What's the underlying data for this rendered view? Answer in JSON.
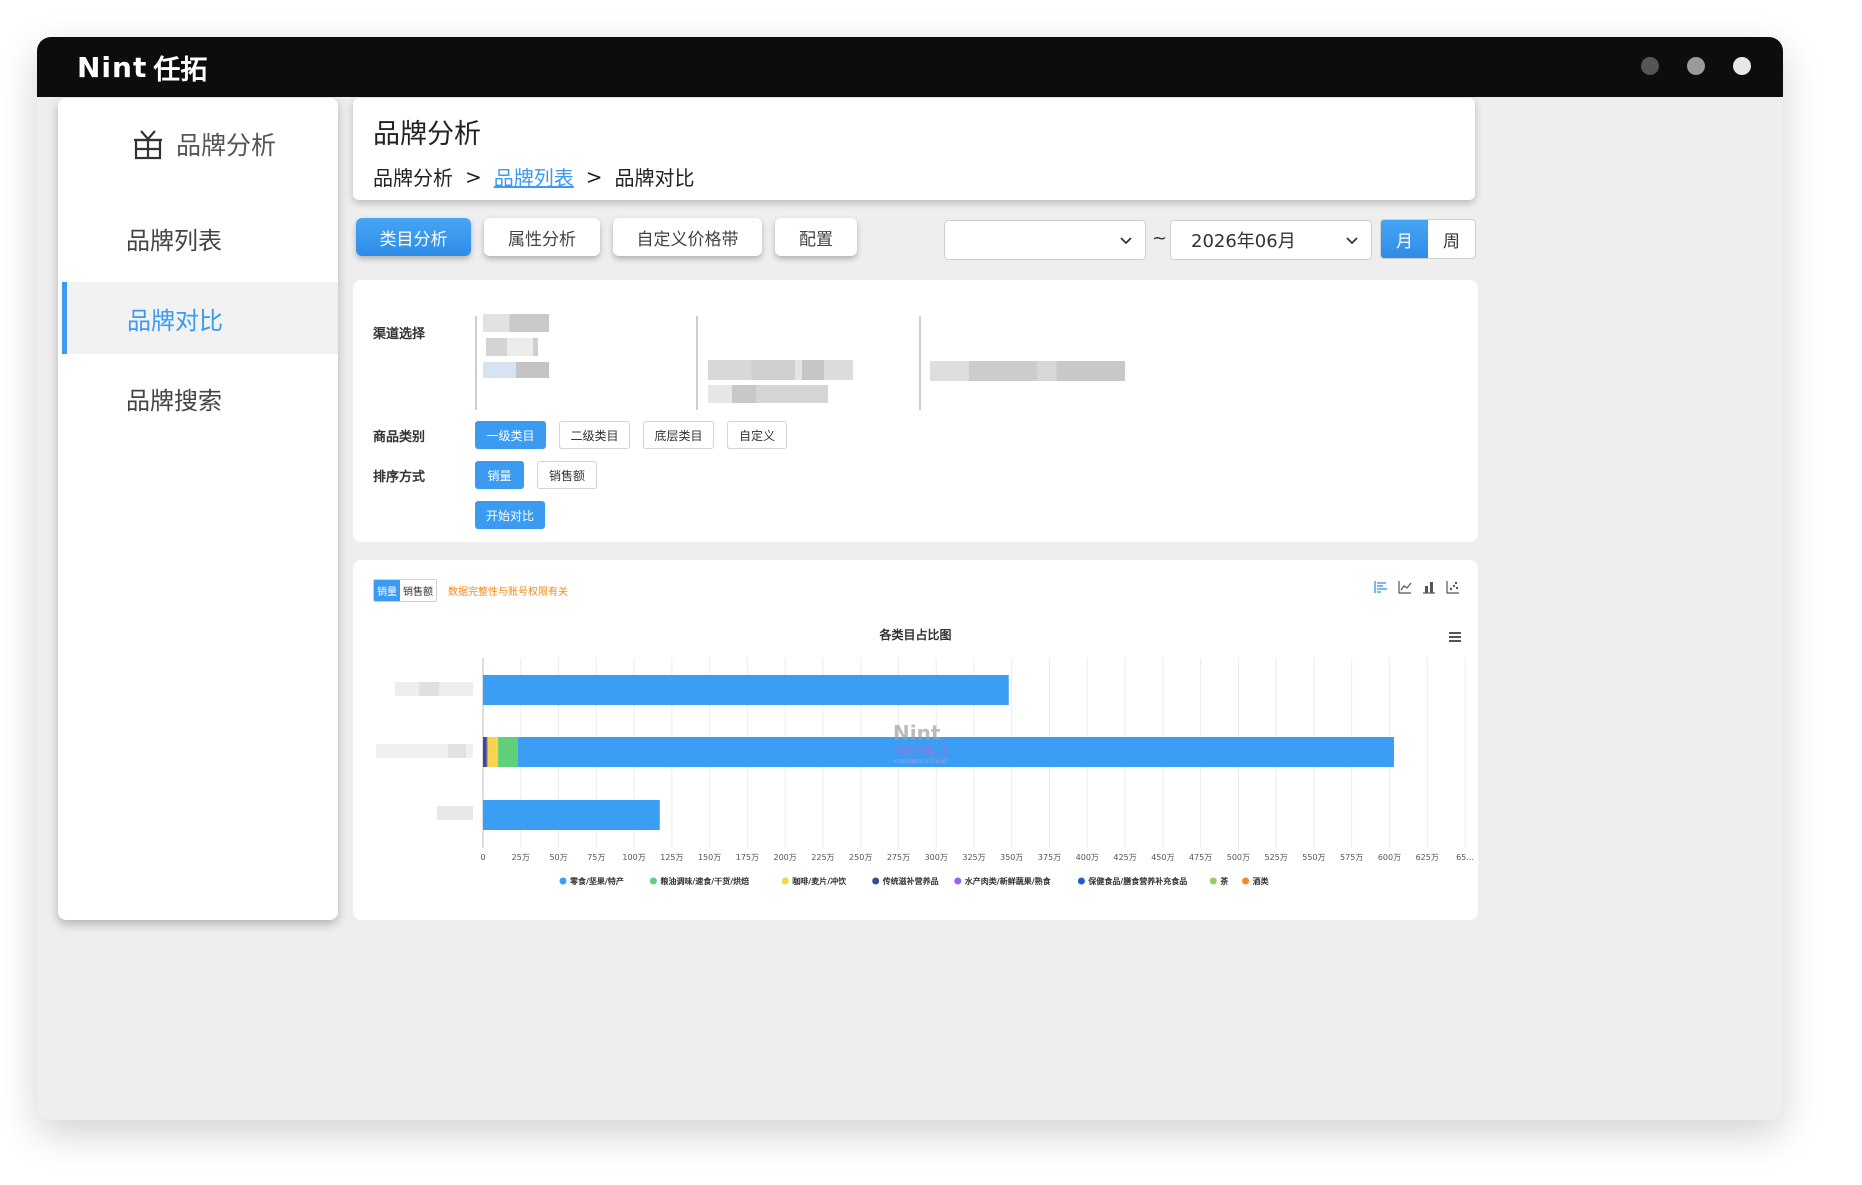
{
  "app": {
    "logo_latin": "Nint",
    "logo_cn": "任拓"
  },
  "window_dots": [
    "#555555",
    "#9a9a9a",
    "#e8e8e8"
  ],
  "sidebar": {
    "title": "品牌分析",
    "items": [
      {
        "label": "品牌列表",
        "active": false
      },
      {
        "label": "品牌对比",
        "active": true
      },
      {
        "label": "品牌搜索",
        "active": false
      }
    ]
  },
  "header": {
    "title": "品牌分析",
    "breadcrumb": [
      "品牌分析",
      "品牌列表",
      "品牌对比"
    ],
    "separator": ">"
  },
  "tabs": [
    {
      "label": "类目分析",
      "active": true
    },
    {
      "label": "属性分析",
      "active": false
    },
    {
      "label": "自定义价格带",
      "active": false
    },
    {
      "label": "配置",
      "active": false
    }
  ],
  "date_range": {
    "start": "",
    "separator": "~",
    "end": "2026年06月"
  },
  "period": {
    "month": "月",
    "week": "周",
    "selected": "月"
  },
  "filters": {
    "channel_label": "渠道选择",
    "category_label": "商品类别",
    "category_options": [
      "一级类目",
      "二级类目",
      "底层类目",
      "自定义"
    ],
    "sort_label": "排序方式",
    "sort_options": [
      "销量",
      "销售额"
    ],
    "start_button": "开始对比"
  },
  "chart_panel": {
    "toggle": [
      "销量",
      "销售额"
    ],
    "notice": "数据完整性与账号权限有关",
    "watermark": "Nint 任拓情报通 Intelligence Cloud"
  },
  "chart_data": {
    "type": "bar",
    "orientation": "horizontal",
    "stacked": true,
    "title": "各类目占比图",
    "categories": [
      "",
      "",
      ""
    ],
    "xlim": [
      0,
      6500000
    ],
    "tick_labels": [
      "0",
      "25万",
      "50万",
      "75万",
      "100万",
      "125万",
      "150万",
      "175万",
      "200万",
      "225万",
      "250万",
      "275万",
      "300万",
      "325万",
      "350万",
      "375万",
      "400万",
      "425万",
      "450万",
      "475万",
      "500万",
      "525万",
      "550万",
      "575万",
      "600万",
      "625万",
      "65..."
    ],
    "grid": true,
    "legend_position": "bottom",
    "series": [
      {
        "name": "零食/坚果/特产",
        "color": "#3a9ef5",
        "values": [
          3480000,
          5800000,
          1170000
        ]
      },
      {
        "name": "粮油调味/速食/干货/烘焙",
        "color": "#5fcf7a",
        "values": [
          0,
          130000,
          0
        ]
      },
      {
        "name": "咖啡/麦片/冲饮",
        "color": "#f7d44a",
        "values": [
          0,
          70000,
          0
        ]
      },
      {
        "name": "传统滋补营养品",
        "color": "#3c4a8c",
        "values": [
          0,
          25000,
          0
        ]
      },
      {
        "name": "水产肉类/新鲜蔬果/熟食",
        "color": "#9a5ff0",
        "values": [
          0,
          5000,
          0
        ]
      },
      {
        "name": "保健食品/膳食营养补充食品",
        "color": "#1f5fc9",
        "values": [
          0,
          0,
          0
        ]
      },
      {
        "name": "茶",
        "color": "#8fd06a",
        "values": [
          0,
          0,
          0
        ]
      },
      {
        "name": "酒类",
        "color": "#f28a1e",
        "values": [
          0,
          0,
          0
        ]
      }
    ]
  }
}
